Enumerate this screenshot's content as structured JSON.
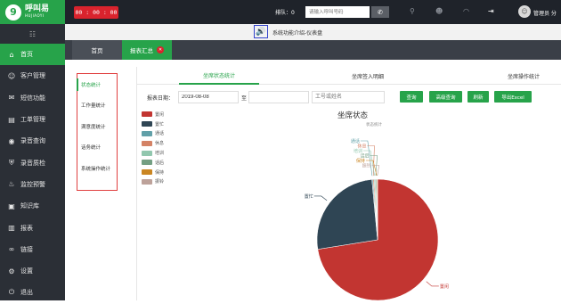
{
  "app": {
    "logo_text": "呼叫易",
    "logo_sub": "HUJIAOYI",
    "logo_mark": "9"
  },
  "sidebar": {
    "items": [
      {
        "label": "首页",
        "icon": "home-icon",
        "glyph": "⌂",
        "active": true
      },
      {
        "label": "客户管理",
        "icon": "user-icon",
        "glyph": "☺",
        "active": false
      },
      {
        "label": "短信功能",
        "icon": "message-icon",
        "glyph": "✉",
        "active": false
      },
      {
        "label": "工单管理",
        "icon": "ticket-icon",
        "glyph": "▤",
        "active": false
      },
      {
        "label": "录音查询",
        "icon": "microphone-icon",
        "glyph": "◉",
        "active": false
      },
      {
        "label": "录音质检",
        "icon": "shield-icon",
        "glyph": "⛨",
        "active": false
      },
      {
        "label": "监控预警",
        "icon": "alarm-icon",
        "glyph": "♨",
        "active": false
      },
      {
        "label": "知识库",
        "icon": "book-icon",
        "glyph": "▣",
        "active": false
      },
      {
        "label": "报表",
        "icon": "bar-chart-icon",
        "glyph": "▥",
        "active": false
      },
      {
        "label": "链接",
        "icon": "link-icon",
        "glyph": "∞",
        "active": false
      },
      {
        "label": "设置",
        "icon": "gear-icon",
        "glyph": "⚙",
        "active": false
      },
      {
        "label": "退出",
        "icon": "power-icon",
        "glyph": "⏻",
        "active": false
      }
    ]
  },
  "topbar": {
    "timer": "00 : 00 : 00",
    "queue": "排队：0",
    "dial_placeholder": "请输入呼叫号码",
    "admin": "管理员 分"
  },
  "announcement": {
    "text": "系统功能介绍-仪表盘"
  },
  "tabs": [
    {
      "label": "首页"
    },
    {
      "label": "报表汇总"
    }
  ],
  "sub_menu": [
    {
      "label": "状态统计",
      "active": true
    },
    {
      "label": "工作量统计",
      "active": false
    },
    {
      "label": "满意度统计",
      "active": false
    },
    {
      "label": "话务统计",
      "active": false
    },
    {
      "label": "系统操作统计",
      "active": false
    }
  ],
  "report_tabs": [
    {
      "label": "坐席状态统计",
      "active": true
    },
    {
      "label": "坐席签入明细",
      "active": false
    },
    {
      "label": "坐席操作统计",
      "active": false
    }
  ],
  "filter": {
    "date_label": "报表日期：",
    "date_from": "2019-08-08",
    "to_label": "至",
    "date_to": "",
    "agent_placeholder": "工号或姓名",
    "buttons": [
      "查询",
      "高级查询",
      "刷新",
      "导出Excel"
    ]
  },
  "chart_data": {
    "type": "pie",
    "title": "坐席状态",
    "subtitle": "状态统计",
    "legend_position": "top-left",
    "slices": [
      {
        "name": "置闲",
        "value": 72.5,
        "color": "#c23531"
      },
      {
        "name": "置忙",
        "value": 26.0,
        "color": "#2f4554"
      },
      {
        "name": "通话",
        "value": 0.3,
        "color": "#61a0a8"
      },
      {
        "name": "休息",
        "value": 0.3,
        "color": "#d48265"
      },
      {
        "name": "培训",
        "value": 0.3,
        "color": "#91c7ae"
      },
      {
        "name": "话后",
        "value": 0.3,
        "color": "#749f83"
      },
      {
        "name": "保持",
        "value": 0.2,
        "color": "#ca8622"
      },
      {
        "name": "振铃",
        "value": 0.1,
        "color": "#bda29a"
      }
    ]
  }
}
